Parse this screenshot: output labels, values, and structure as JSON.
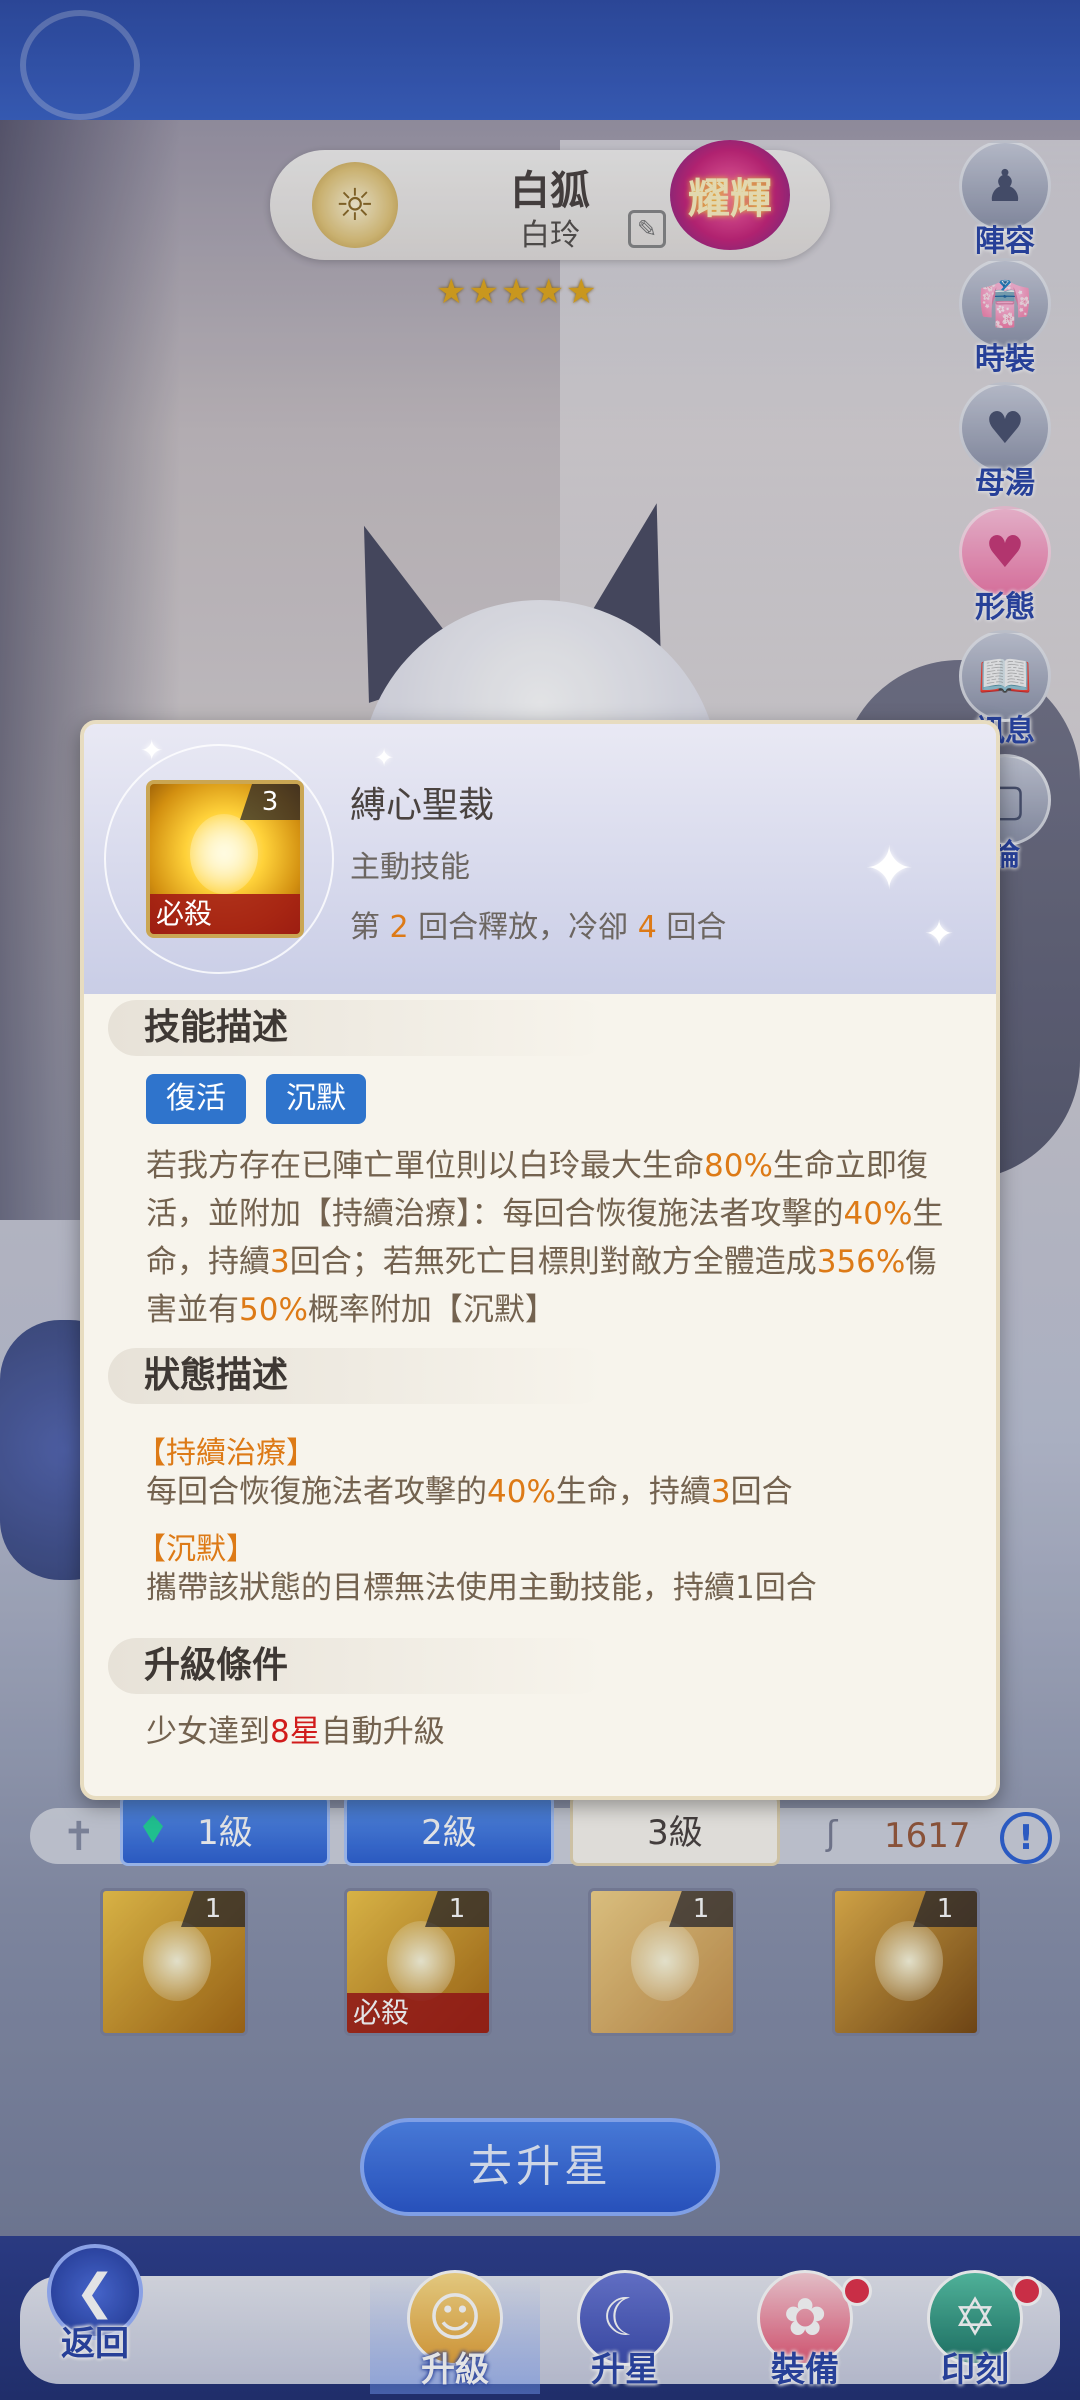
{
  "character": {
    "name": "白狐",
    "subname": "白玲",
    "rank_badge": "耀輝",
    "stars": [
      "★",
      "★",
      "★",
      "★",
      "★"
    ]
  },
  "side_menu": [
    {
      "label": "陣容",
      "icon": "♟"
    },
    {
      "label": "時裝",
      "icon": "👘"
    },
    {
      "label": "母湯",
      "icon": "♥"
    },
    {
      "label": "形態",
      "icon": "♥"
    },
    {
      "label": "訊息",
      "icon": "📖"
    },
    {
      "label": "論",
      "icon": "▢"
    }
  ],
  "dialog": {
    "skill_name": "縛心聖裁",
    "skill_level": "3",
    "skill_tag": "必殺",
    "skill_type": "主動技能",
    "cd_prefix": "第 ",
    "cd_turn": "2",
    "cd_mid": " 回合釋放，冷卻 ",
    "cd_cool": "4",
    "cd_suffix": " 回合",
    "section_skill_desc": "技能描述",
    "tags": [
      "復活",
      "沉默"
    ],
    "desc": {
      "p1": "若我方存在已陣亡單位則以白玲最大生命",
      "v1": "80%",
      "p2": "生命立即復活，並附加【持續治療】：每回合恢復施法者攻擊的",
      "v2": "40%",
      "p3": "生命，持續",
      "v3": "3",
      "p4": "回合；若無死亡目標則對敵方全體造成",
      "v4": "356%",
      "p5": "傷害並有",
      "v5": "50%",
      "p6": "概率附加【沉默】"
    },
    "section_state_desc": "狀態描述",
    "states": {
      "s1_title": "【持續治療】",
      "s1_p1": "每回合恢復施法者攻擊的",
      "s1_v1": "40%",
      "s1_p2": "生命，持續",
      "s1_v2": "3",
      "s1_p3": "回合",
      "s2_title": "【沉默】",
      "s2_text": "攜帶該狀態的目標無法使用主動技能，持續1回合"
    },
    "section_upgrade": "升級條件",
    "upgrade": {
      "p1": "少女達到",
      "v1": "8星",
      "p2": "自動升級"
    }
  },
  "level_tabs": [
    "1級",
    "2級",
    "3級"
  ],
  "currency": "1617",
  "skill_slots": [
    {
      "level": "1",
      "tag": ""
    },
    {
      "level": "1",
      "tag": "必殺"
    },
    {
      "level": "1",
      "tag": ""
    },
    {
      "level": "1",
      "tag": ""
    }
  ],
  "upstar_button": "去升星",
  "bottom_nav": {
    "back": "返回",
    "items": [
      "升級",
      "升星",
      "裝備",
      "印刻"
    ]
  }
}
